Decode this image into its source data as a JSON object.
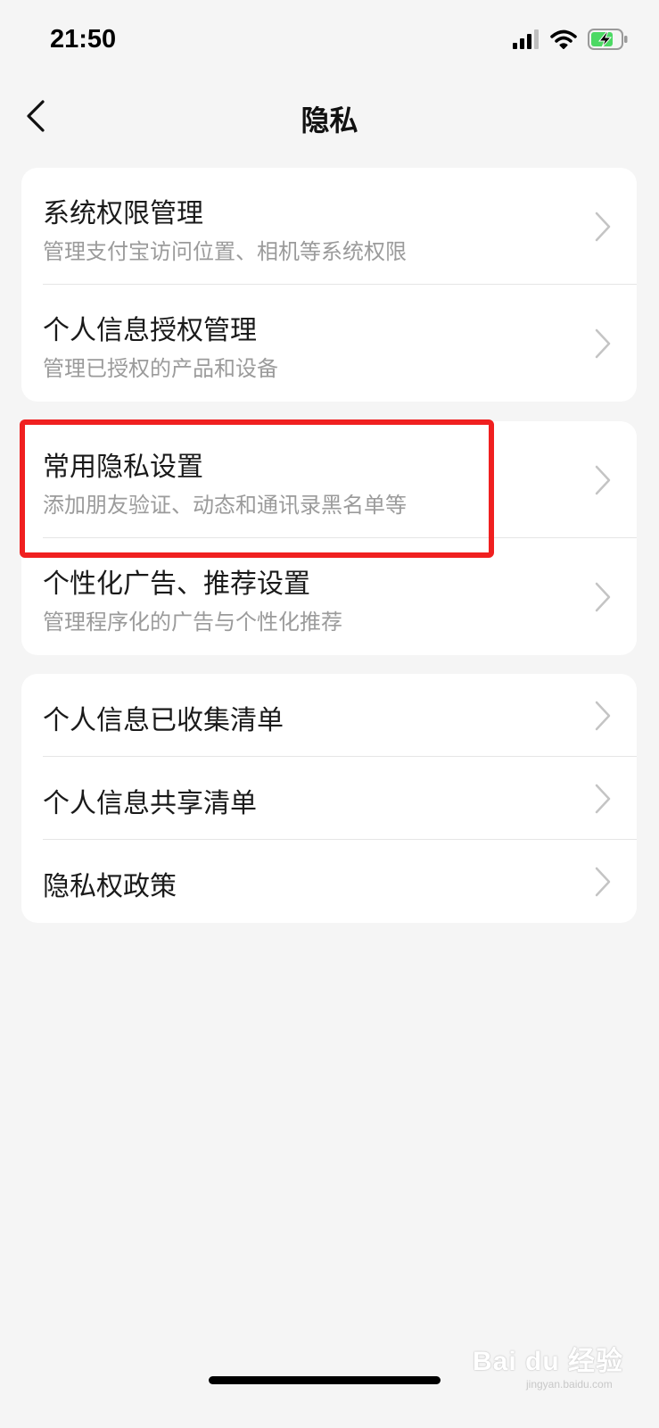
{
  "status_bar": {
    "time": "21:50",
    "icons": [
      "signal-icon",
      "wifi-icon",
      "battery-charging-icon"
    ],
    "battery_color": "#4cd964"
  },
  "nav": {
    "title": "隐私",
    "back_icon": "chevron-left-icon"
  },
  "groups": [
    {
      "items": [
        {
          "title": "系统权限管理",
          "subtitle": "管理支付宝访问位置、相机等系统权限"
        },
        {
          "title": "个人信息授权管理",
          "subtitle": "管理已授权的产品和设备"
        }
      ]
    },
    {
      "items": [
        {
          "title": "常用隐私设置",
          "subtitle": "添加朋友验证、动态和通讯录黑名单等",
          "highlighted": true
        },
        {
          "title": "个性化广告、推荐设置",
          "subtitle": "管理程序化的广告与个性化推荐"
        }
      ]
    },
    {
      "items": [
        {
          "title": "个人信息已收集清单"
        },
        {
          "title": "个人信息共享清单"
        },
        {
          "title": "隐私权政策"
        }
      ]
    }
  ],
  "highlight_color": "#f02020",
  "watermark": {
    "main": "Bai du 经验",
    "sub": "jingyan.baidu.com"
  }
}
